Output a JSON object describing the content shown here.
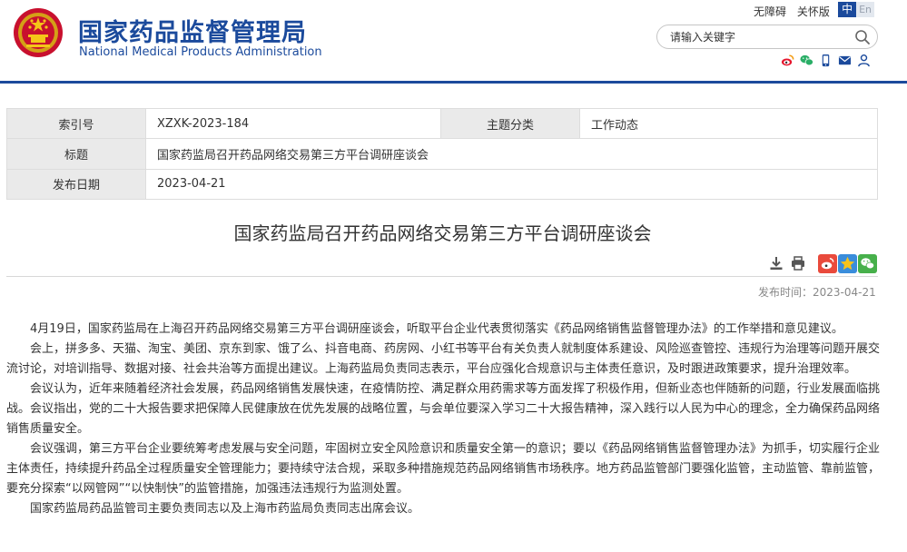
{
  "header": {
    "title_cn": "国家药品监督管理局",
    "title_en": "National Medical Products Administration",
    "accessibility_label": "无障碍",
    "care_mode_label": "关怀版",
    "lang_cn": "中",
    "lang_en": "En",
    "search_placeholder": "请输入关键字",
    "social_icons": [
      "weibo-icon",
      "wechat-icon",
      "mobile-icon",
      "mail-icon",
      "user-icon"
    ],
    "brand_color": "#1b4a9c"
  },
  "info": {
    "index_label": "索引号",
    "index_value": "XZXK-2023-184",
    "category_label": "主题分类",
    "category_value": "工作动态",
    "title_label": "标题",
    "title_value": "国家药监局召开药品网络交易第三方平台调研座谈会",
    "date_label": "发布日期",
    "date_value": "2023-04-21"
  },
  "article": {
    "title": "国家药监局召开药品网络交易第三方平台调研座谈会",
    "pub_time": "发布时间：2023-04-21",
    "paragraphs": [
      "4月19日，国家药监局在上海召开药品网络交易第三方平台调研座谈会，听取平台企业代表贯彻落实《药品网络销售监督管理办法》的工作举措和意见建议。",
      "会上，拼多多、天猫、淘宝、美团、京东到家、饿了么、抖音电商、药房网、小红书等平台有关负责人就制度体系建设、风险巡查管控、违规行为治理等问题开展交流讨论，对培训指导、数据对接、社会共治等方面提出建议。上海药监局负责同志表示，平台应强化合规意识与主体责任意识，及时跟进政策要求，提升治理效率。",
      "会议认为，近年来随着经济社会发展，药品网络销售发展快速，在疫情防控、满足群众用药需求等方面发挥了积极作用，但新业态也伴随新的问题，行业发展面临挑战。会议指出，党的二十大报告要求把保障人民健康放在优先发展的战略位置，与会单位要深入学习二十大报告精神，深入践行以人民为中心的理念，全力确保药品网络销售质量安全。",
      "会议强调，第三方平台企业要统筹考虑发展与安全问题，牢固树立安全风险意识和质量安全第一的意识；要以《药品网络销售监督管理办法》为抓手，切实履行企业主体责任，持续提升药品全过程质量安全管理能力；要持续守法合规，采取多种措施规范药品网络销售市场秩序。地方药品监管部门要强化监管，主动监管、靠前监管，要充分探索“以网管网”“以快制快”的监管措施，加强违法违规行为监测处置。",
      "国家药监局药品监管司主要负责同志以及上海市药监局负责同志出席会议。"
    ]
  }
}
